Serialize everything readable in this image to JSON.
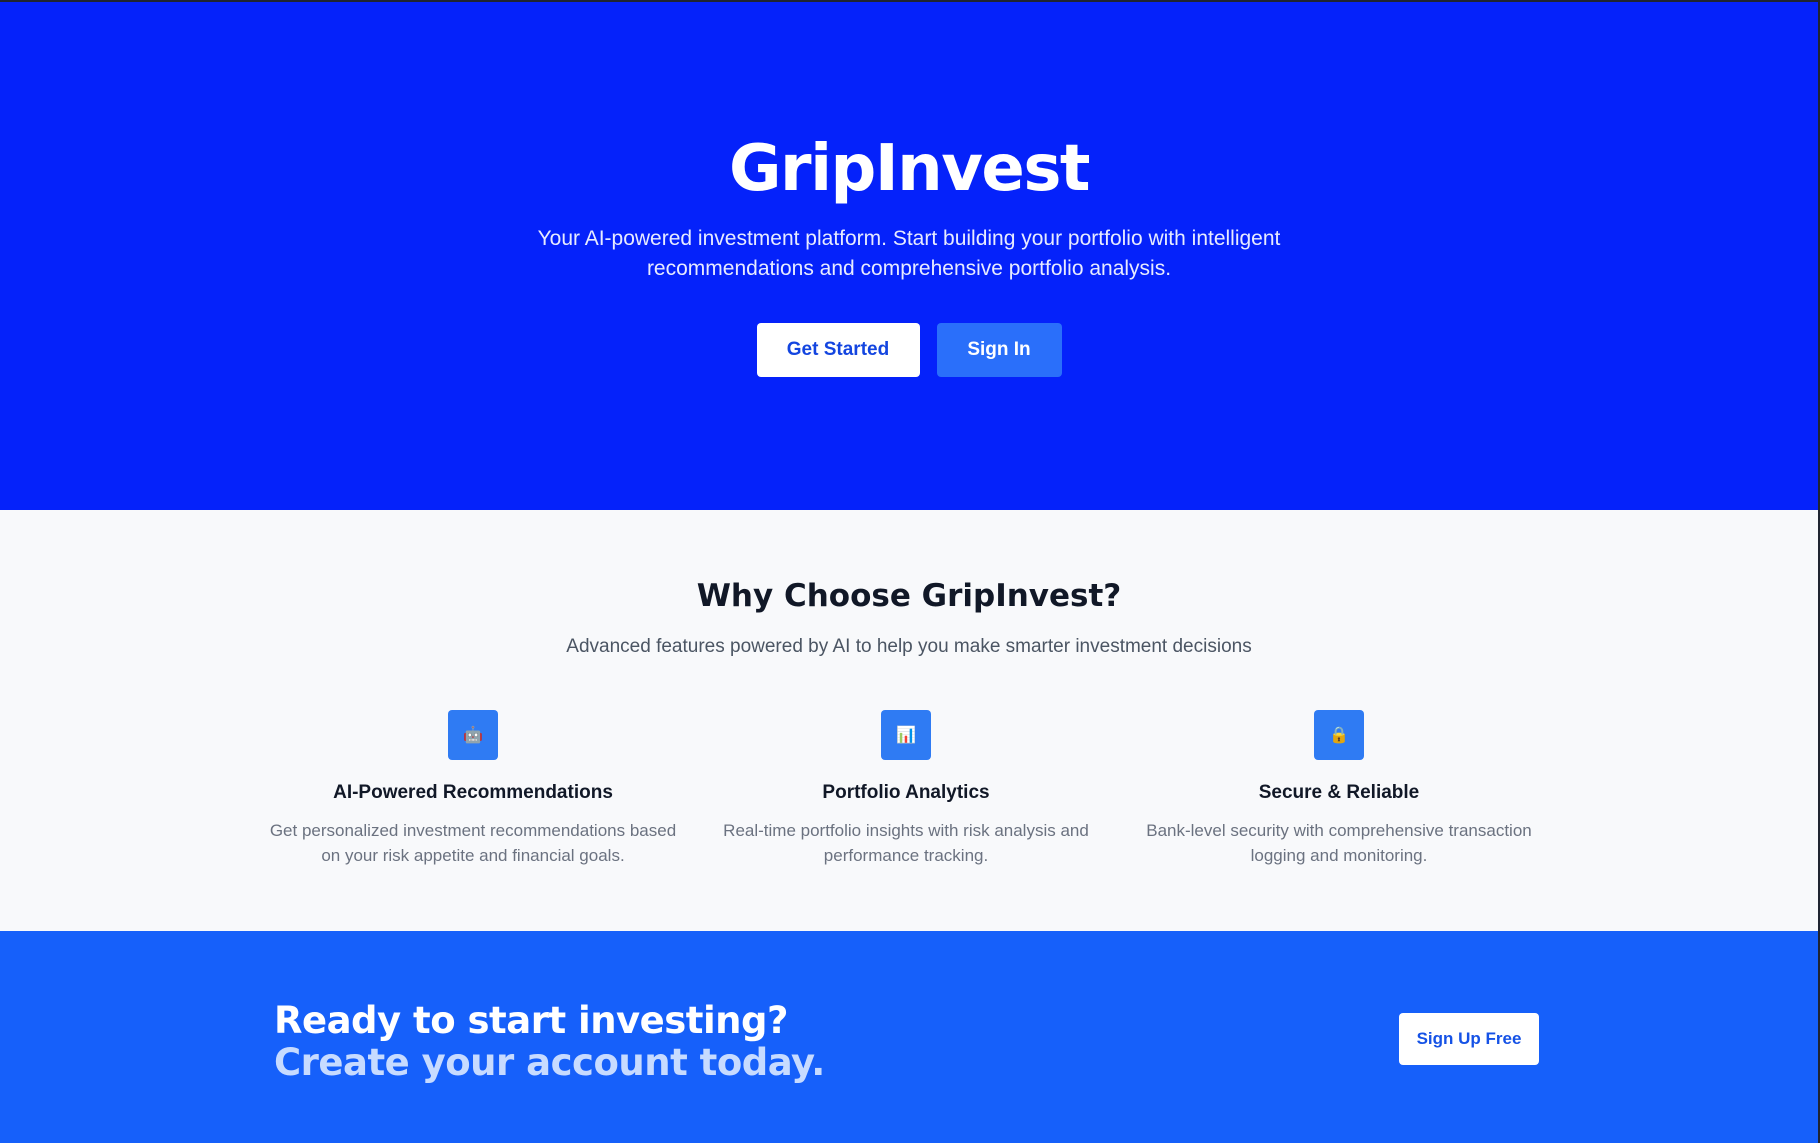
{
  "hero": {
    "title": "GripInvest",
    "subtitle": "Your AI-powered investment platform. Start building your portfolio with intelligent recommendations and comprehensive portfolio analysis.",
    "primary_button": "Get Started",
    "secondary_button": "Sign In"
  },
  "features": {
    "title": "Why Choose GripInvest?",
    "subtitle": "Advanced features powered by AI to help you make smarter investment decisions",
    "items": [
      {
        "icon": "robot-icon",
        "glyph": "🤖",
        "title": "AI-Powered Recommendations",
        "description": "Get personalized investment recommendations based on your risk appetite and financial goals."
      },
      {
        "icon": "chart-icon",
        "glyph": "📊",
        "title": "Portfolio Analytics",
        "description": "Real-time portfolio insights with risk analysis and performance tracking."
      },
      {
        "icon": "lock-icon",
        "glyph": "🔒",
        "title": "Secure & Reliable",
        "description": "Bank-level security with comprehensive transaction logging and monitoring."
      }
    ]
  },
  "cta": {
    "line1": "Ready to start investing?",
    "line2": "Create your account today.",
    "button": "Sign Up Free"
  },
  "colors": {
    "hero_bg": "#0522fa",
    "cta_bg": "#1660fa",
    "accent": "#2f7bf3",
    "features_bg": "#f8f9fb"
  }
}
